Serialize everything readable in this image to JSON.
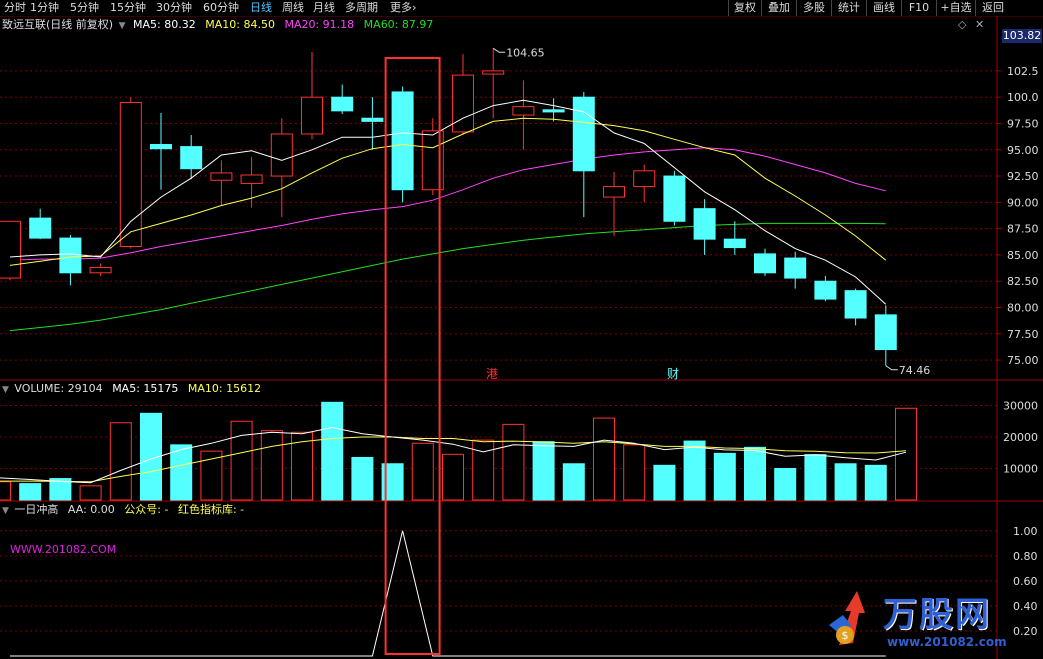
{
  "toolbar": {
    "tabs": [
      "分时",
      "1分钟",
      "5分钟",
      "15分钟",
      "30分钟",
      "60分钟",
      "日线",
      "周线",
      "月线",
      "多周期",
      "更多"
    ],
    "active_tab": "日线",
    "right_buttons": [
      "复权",
      "叠加",
      "多股",
      "统计",
      "画线",
      "F10",
      "+自选",
      "返回"
    ]
  },
  "main_header": {
    "title": "致远互联(日线 前复权)",
    "ma5": "MA5: 80.32",
    "ma10": "MA10: 84.50",
    "ma20": "MA20: 91.18",
    "ma60": "MA60: 87.97"
  },
  "price_axis": {
    "current_price": "103.82",
    "ticks": [
      "102.5",
      "100.0",
      "97.50",
      "95.00",
      "92.50",
      "90.00",
      "87.50",
      "85.00",
      "82.50",
      "80.00",
      "77.50",
      "75.00"
    ],
    "high_label": "104.65",
    "low_label": "74.46"
  },
  "markers": {
    "gang": "港",
    "cai": "财"
  },
  "volume_header": {
    "volume": "VOLUME: 29104",
    "ma5": "MA5: 15175",
    "ma10": "MA10: 15612"
  },
  "volume_axis": {
    "ticks": [
      "30000",
      "20000",
      "10000"
    ]
  },
  "indicator_header": {
    "name": "一日冲高",
    "aa": "AA: 0.00",
    "gzh": "公众号: -",
    "lib": "红色指标库: -"
  },
  "indicator_axis": {
    "ticks": [
      "1.00",
      "0.80",
      "0.60",
      "0.40",
      "0.20"
    ]
  },
  "watermark": "WWW.201082.COM",
  "logo": {
    "text": "万股网",
    "url": "www.201082.com"
  },
  "colors": {
    "up": "#ff3232",
    "down": "#54ffff",
    "ma5": "#ffffff",
    "ma10": "#ffff55",
    "ma20": "#ff44ff",
    "ma60": "#22dd22",
    "grid": "#800000",
    "highlight": "#ff3030"
  },
  "chart_data": {
    "type": "candlestick",
    "title": "致远互联(日线 前复权)",
    "candles": [
      {
        "o": 82.8,
        "h": 88.2,
        "l": 82.6,
        "c": 88.2
      },
      {
        "o": 88.5,
        "h": 89.4,
        "l": 86.5,
        "c": 86.6
      },
      {
        "o": 86.6,
        "h": 86.9,
        "l": 82.1,
        "c": 83.3
      },
      {
        "o": 83.3,
        "h": 84.2,
        "l": 83.0,
        "c": 83.8
      },
      {
        "o": 85.8,
        "h": 100.0,
        "l": 85.6,
        "c": 99.5
      },
      {
        "o": 95.5,
        "h": 98.5,
        "l": 91.2,
        "c": 95.1
      },
      {
        "o": 95.3,
        "h": 96.4,
        "l": 92.2,
        "c": 93.2
      },
      {
        "o": 92.1,
        "h": 94.0,
        "l": 89.7,
        "c": 92.8
      },
      {
        "o": 91.8,
        "h": 94.3,
        "l": 89.5,
        "c": 92.6
      },
      {
        "o": 92.5,
        "h": 98.0,
        "l": 88.6,
        "c": 96.5
      },
      {
        "o": 96.5,
        "h": 104.3,
        "l": 96.0,
        "c": 100.0
      },
      {
        "o": 100.0,
        "h": 101.2,
        "l": 98.4,
        "c": 98.7
      },
      {
        "o": 98.0,
        "h": 100.0,
        "l": 95.0,
        "c": 97.7
      },
      {
        "o": 100.5,
        "h": 101.0,
        "l": 90.0,
        "c": 91.2
      },
      {
        "o": 91.2,
        "h": 98.0,
        "l": 90.7,
        "c": 96.8
      },
      {
        "o": 96.7,
        "h": 104.1,
        "l": 96.4,
        "c": 102.1
      },
      {
        "o": 102.2,
        "h": 104.65,
        "l": 98.0,
        "c": 102.5
      },
      {
        "o": 98.3,
        "h": 101.6,
        "l": 95.0,
        "c": 99.1
      },
      {
        "o": 98.8,
        "h": 99.9,
        "l": 97.7,
        "c": 98.6
      },
      {
        "o": 100.0,
        "h": 100.5,
        "l": 88.6,
        "c": 93.0
      },
      {
        "o": 90.5,
        "h": 92.9,
        "l": 86.8,
        "c": 91.5
      },
      {
        "o": 91.5,
        "h": 93.6,
        "l": 90.0,
        "c": 93.0
      },
      {
        "o": 92.5,
        "h": 93.0,
        "l": 87.8,
        "c": 88.2
      },
      {
        "o": 89.4,
        "h": 90.3,
        "l": 85.0,
        "c": 86.5
      },
      {
        "o": 86.5,
        "h": 88.2,
        "l": 85.0,
        "c": 85.7
      },
      {
        "o": 85.1,
        "h": 85.6,
        "l": 83.0,
        "c": 83.3
      },
      {
        "o": 84.7,
        "h": 85.3,
        "l": 81.8,
        "c": 82.8
      },
      {
        "o": 82.5,
        "h": 83.0,
        "l": 80.6,
        "c": 80.8
      },
      {
        "o": 81.6,
        "h": 81.8,
        "l": 78.3,
        "c": 79.0
      },
      {
        "o": 79.3,
        "h": 80.2,
        "l": 74.46,
        "c": 76.0
      }
    ],
    "ma5": [
      84.8,
      85.0,
      85.1,
      84.8,
      88.2,
      90.5,
      92.3,
      94.5,
      94.9,
      94.0,
      95.0,
      96.2,
      96.2,
      96.6,
      96.4,
      98.0,
      99.2,
      99.7,
      99.2,
      98.6,
      96.6,
      95.6,
      93.3,
      91.0,
      89.3,
      87.3,
      85.6,
      84.5,
      82.9,
      80.3
    ],
    "ma10": [
      84.0,
      84.4,
      84.8,
      84.9,
      87.2,
      88.0,
      88.8,
      89.7,
      90.4,
      91.3,
      92.8,
      94.2,
      95.1,
      95.5,
      95.2,
      96.5,
      97.7,
      98.0,
      97.9,
      97.6,
      97.3,
      96.8,
      96.0,
      95.2,
      94.5,
      92.3,
      90.6,
      88.8,
      86.8,
      84.5
    ],
    "ma20": [
      84.5,
      84.6,
      84.6,
      84.7,
      85.2,
      85.8,
      86.3,
      86.8,
      87.3,
      87.8,
      88.4,
      88.9,
      89.3,
      89.6,
      90.2,
      91.2,
      92.3,
      93.1,
      93.6,
      94.1,
      94.5,
      94.8,
      95.0,
      95.2,
      95.0,
      94.4,
      93.6,
      92.8,
      91.8,
      91.1
    ],
    "ma60": [
      77.8,
      78.1,
      78.4,
      78.8,
      79.3,
      79.8,
      80.4,
      81.0,
      81.6,
      82.2,
      82.8,
      83.4,
      84.0,
      84.6,
      85.1,
      85.6,
      86.0,
      86.4,
      86.7,
      87.0,
      87.2,
      87.4,
      87.6,
      87.8,
      87.9,
      88.0,
      88.0,
      88.0,
      88.0,
      87.97
    ],
    "volume": [
      5800,
      5200,
      6800,
      4500,
      24500,
      27500,
      17500,
      15500,
      25000,
      22000,
      21500,
      31000,
      13500,
      11500,
      18000,
      14500,
      19000,
      24000,
      18500,
      11500,
      26000,
      17500,
      11000,
      18700,
      14800,
      16700,
      10000,
      14400,
      11500,
      11000,
      29104
    ],
    "volume_ma5": [
      7000,
      6500,
      5900,
      5500,
      9400,
      13000,
      16000,
      18000,
      20500,
      21500,
      21000,
      23000,
      21000,
      20000,
      19000,
      17700,
      15300,
      17500,
      17200,
      17000,
      19000,
      18000,
      16000,
      16800,
      15900,
      15700,
      13900,
      14300,
      13400,
      12700,
      15175
    ],
    "volume_ma10": [
      6000,
      6000,
      5900,
      5800,
      7500,
      9000,
      11000,
      13000,
      15000,
      17000,
      18500,
      19500,
      20000,
      20000,
      19500,
      19500,
      18500,
      18700,
      18400,
      18000,
      18500,
      17800,
      17000,
      17000,
      16500,
      16300,
      15600,
      15500,
      15000,
      14900,
      15612
    ],
    "indicator": [
      0,
      0,
      0,
      0,
      0,
      0,
      0,
      0,
      0,
      0,
      0,
      0,
      0,
      1,
      0,
      0,
      0,
      0,
      0,
      0,
      0,
      0,
      0,
      0,
      0,
      0,
      0,
      0,
      0,
      0
    ],
    "price_range": [
      73.2,
      106.2
    ],
    "volume_range": [
      0,
      33000
    ],
    "indicator_range": [
      0,
      1.15
    ]
  }
}
